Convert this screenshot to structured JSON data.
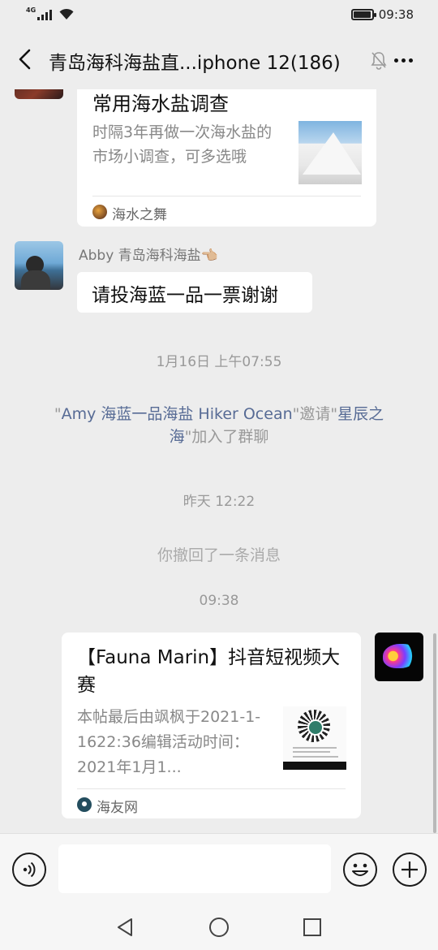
{
  "status_bar": {
    "network": "4G",
    "time": "09:38",
    "battery_level": 0.95
  },
  "header": {
    "title": "青岛海科海盐直...iphone 12(186)"
  },
  "messages": {
    "link_card_1": {
      "title": "常用海水盐调查",
      "description": "时隔3年再做一次海水盐的市场小调查，可多选哦",
      "source": "海水之舞"
    },
    "text_message": {
      "sender": "Abby 青岛海科海盐👈🏼",
      "text": "请投海蓝一品一票谢谢"
    },
    "timestamp_1": "1月16日 上午07:55",
    "invite_notice": {
      "quote_open_1": "\"",
      "inviter": "Amy 海蓝一品海盐 Hiker Ocean",
      "middle": "\"邀请\"",
      "invitee": "星辰之海",
      "end": "\"加入了群聊"
    },
    "timestamp_2": "昨天 12:22",
    "recall_notice": "你撤回了一条消息",
    "timestamp_3": "09:38",
    "link_card_2": {
      "title": "【Fauna Marin】抖音短视频大赛",
      "description": "本帖最后由飒枫于2021-1-1622:36编辑活动时间：2021年1月1...",
      "source": "海友网"
    }
  },
  "input_bar": {
    "value": "",
    "placeholder": ""
  }
}
